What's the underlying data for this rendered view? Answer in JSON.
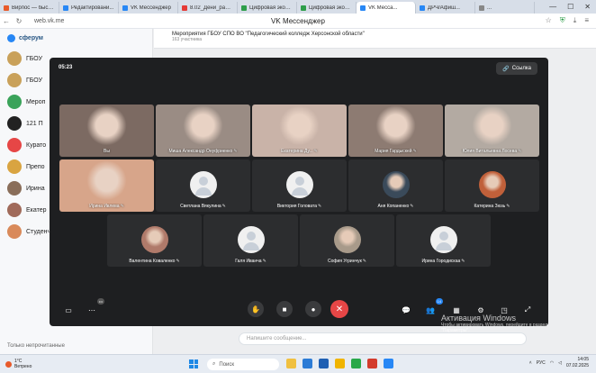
{
  "browser": {
    "tabs": [
      {
        "label": "Вирпос — быстр...",
        "color": "#e85a2a"
      },
      {
        "label": "Редактировани...",
        "color": "#2787f5"
      },
      {
        "label": "VK Мессенджер",
        "color": "#2787f5"
      },
      {
        "label": "8.02_Дени_рассы...",
        "color": "#e53935"
      },
      {
        "label": "Цифровая экосист...",
        "color": "#2e9e4a"
      },
      {
        "label": "Цифровая экосист...",
        "color": "#2e9e4a"
      },
      {
        "label": "VK Месса...",
        "color": "#2787f5",
        "active": true
      },
      {
        "label": "ДРЧ/Афиш...",
        "color": "#2787f5"
      },
      {
        "label": "...",
        "color": "#888888"
      }
    ],
    "url": "web.vk.me",
    "page_title": "VK Мессенджер"
  },
  "sidebar": {
    "logo": "сферум",
    "chats": [
      {
        "name": "ГБОУ",
        "color": "#c9a15a"
      },
      {
        "name": "ГБОУ",
        "color": "#c9a15a"
      },
      {
        "name": "Мероп",
        "color": "#3aa35a"
      },
      {
        "name": "121 П",
        "color": "#222222"
      },
      {
        "name": "Курато",
        "color": "#e64646"
      },
      {
        "name": "Препо",
        "color": "#d9a441"
      },
      {
        "name": "Ирина",
        "color": "#8a6e5a"
      },
      {
        "name": "Екатер",
        "color": "#a06a5a"
      },
      {
        "name": "Студенческий Совет",
        "color": "#d98a5a"
      }
    ],
    "bottom_text": "Только непрочитанные"
  },
  "chat_header": {
    "title": "Мероприятия ГБОУ СПО ВО \"Педагогический колледж Херсонской области\"",
    "subtitle": "163 участника"
  },
  "composer": {
    "placeholder": "Напишите сообщение..."
  },
  "call": {
    "timer": "05:23",
    "link_label": "Ссылка",
    "participants": [
      {
        "name": "Вы",
        "kind": "photo",
        "bg": "#7c6a62"
      },
      {
        "name": "Миша Александр Онуфриенко",
        "kind": "photo",
        "bg": "#9a8c84"
      },
      {
        "name": "Екатерина Ду...",
        "kind": "photo",
        "bg": "#c9b3a8"
      },
      {
        "name": "Мария Гардыскей",
        "kind": "photo",
        "bg": "#8d7b72"
      },
      {
        "name": "Юлия Витальевна Лосева",
        "kind": "photo",
        "bg": "#b3aaa2"
      },
      {
        "name": "Ирина Ивлева",
        "kind": "photo",
        "bg": "#d7a58a"
      },
      {
        "name": "Светлана Вякулина",
        "kind": "placeholder"
      },
      {
        "name": "Виктория Головата",
        "kind": "placeholder"
      },
      {
        "name": "Аня Копаненко",
        "kind": "avatar",
        "ava": "#3a4a5a"
      },
      {
        "name": "Катерина Зюзь",
        "kind": "avatar",
        "ava": "#c0603a"
      },
      {
        "name": "Валентина Коваленко",
        "kind": "avatar",
        "ava": "#b07a6a"
      },
      {
        "name": "Галя Иванча",
        "kind": "placeholder"
      },
      {
        "name": "София Угринчук",
        "kind": "avatar",
        "ava": "#a89a8a"
      },
      {
        "name": "Ирина Городискаа",
        "kind": "placeholder"
      }
    ],
    "participants_badge": "14",
    "more_badge": "•••"
  },
  "activation": {
    "title": "Активация Windows",
    "text": "Чтобы активировать Windows, перейдите в раздел \"Параметры\"."
  },
  "taskbar": {
    "temp": "1°C",
    "weather": "Ветрено",
    "search": "Поиск",
    "lang": "РУС",
    "time": "14:05",
    "date": "07.02.2025"
  }
}
